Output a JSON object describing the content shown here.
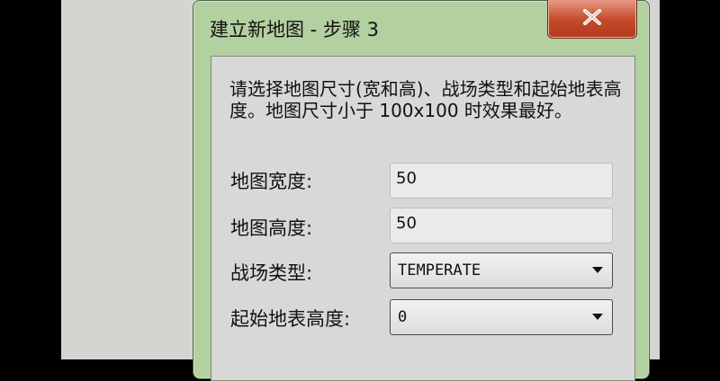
{
  "window": {
    "title": "建立新地图 - 步骤 3"
  },
  "instructions": "请选择地图尺寸(宽和高)、战场类型和起始地表高度。地图尺寸小于 100x100 时效果最好。",
  "fields": {
    "map_width": {
      "label": "地图宽度:",
      "value": "50"
    },
    "map_height": {
      "label": "地图高度:",
      "value": "50"
    },
    "battlefield_type": {
      "label": "战场类型:",
      "value": "TEMPERATE"
    },
    "start_height": {
      "label": "起始地表高度:",
      "value": "0"
    }
  },
  "icons": {
    "close": "close-icon",
    "dropdown": "chevron-down-icon"
  },
  "colors": {
    "title_bar": "#b3d0a1",
    "close_button": "#c44a2a",
    "client_area": "#d8d8d8",
    "desktop": "#d2d5d0"
  }
}
